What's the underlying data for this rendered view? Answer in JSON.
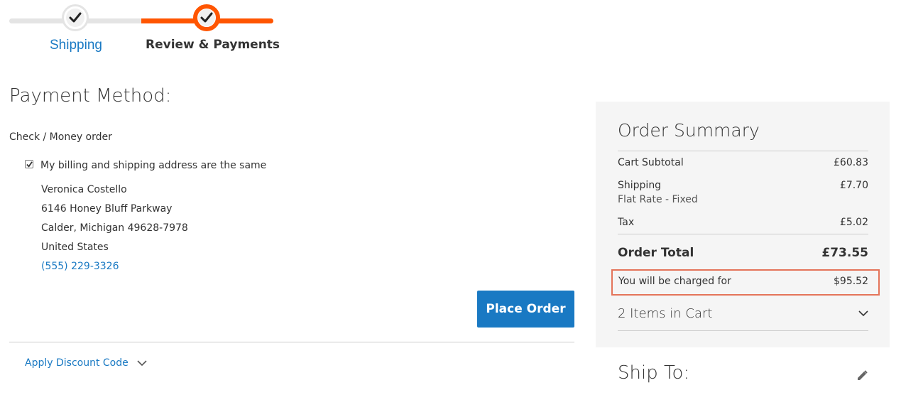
{
  "progress": {
    "steps": [
      {
        "label": "Shipping",
        "status": "complete"
      },
      {
        "label": "Review & Payments",
        "status": "active"
      }
    ],
    "check_icon": "checkmark-icon",
    "active_color": "#ff5501",
    "link_color": "#1979c3"
  },
  "payment": {
    "title": "Payment Method:",
    "method": "Check / Money order",
    "billing_same_label": "My billing and shipping address are the same",
    "billing_same_checked": true,
    "address": {
      "name": "Veronica Costello",
      "street": "6146 Honey Bluff Parkway",
      "city_line": "Calder, Michigan 49628-7978",
      "country": "United States",
      "phone": "(555) 229-3326"
    },
    "place_order_label": "Place Order",
    "discount_label": "Apply Discount Code"
  },
  "summary": {
    "title": "Order Summary",
    "subtotal_label": "Cart Subtotal",
    "subtotal_value": "£60.83",
    "shipping_label": "Shipping",
    "shipping_value": "£7.70",
    "shipping_method": "Flat Rate - Fixed",
    "tax_label": "Tax",
    "tax_value": "£5.02",
    "total_label": "Order Total",
    "total_value": "£73.55",
    "charged_label": "You will be charged for",
    "charged_value": "$95.52",
    "items_label": "2 Items in Cart",
    "highlight_color": "#e4745a"
  },
  "ship_to": {
    "title": "Ship To:"
  }
}
